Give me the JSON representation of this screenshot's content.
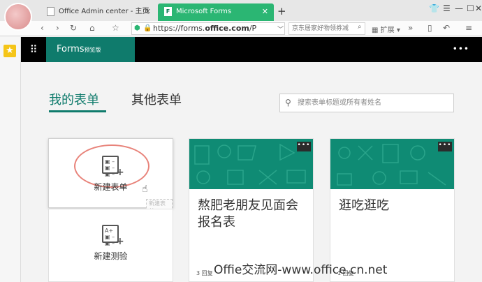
{
  "browser": {
    "tabs": [
      {
        "title": "Office Admin center - 主页",
        "close": "✕"
      },
      {
        "title": "Microsoft Forms",
        "close": "✕"
      }
    ],
    "new_tab": "+",
    "url_prefix": "https://forms.",
    "url_domain": "office.com",
    "url_suffix": "/P",
    "search_text": "京东居家好物领券减",
    "ext_label": "扩展"
  },
  "forms": {
    "brand": "Forms",
    "brand_sub": "预览版",
    "more": "•••",
    "tab_mine": "我的表单",
    "tab_other": "其他表单",
    "search_placeholder": "搜索表单标题或所有者姓名",
    "new_form": "新建表单",
    "new_quiz": "新建测验",
    "ghost_label": "新建表单",
    "cards": [
      {
        "title": "熬肥老朋友见面会报名表",
        "responses": "3 回复"
      },
      {
        "title": "逛吃逛吃",
        "responses": "1 回复"
      }
    ]
  },
  "watermark": "Offie交流网-www.office.cn.net"
}
